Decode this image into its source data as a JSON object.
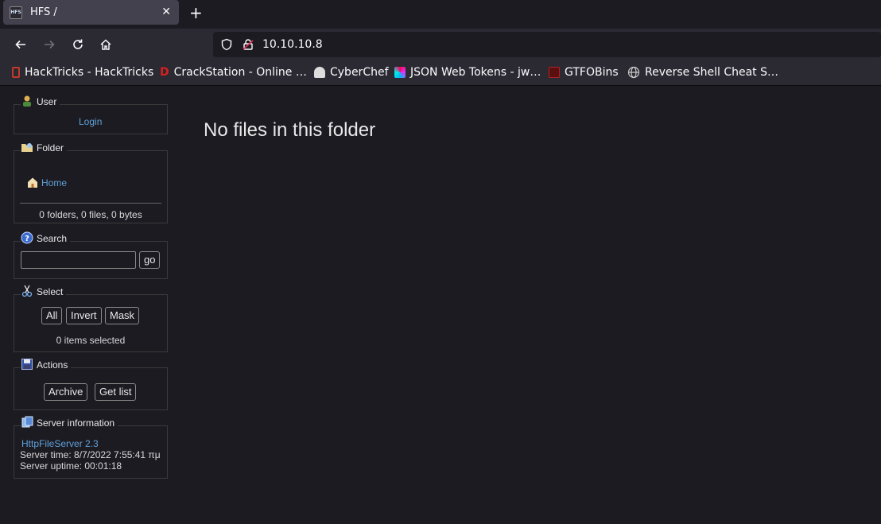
{
  "browser": {
    "tab_title": "HFS /",
    "tab_favicon_text": "HFS",
    "url": "10.10.10.8",
    "bookmarks": [
      {
        "label": "HackTricks - HackTricks",
        "icon": "hacktricks-icon",
        "color": "#c0392b"
      },
      {
        "label": "CrackStation - Online …",
        "icon": "crackstation-icon",
        "color": "#d62020"
      },
      {
        "label": "CyberChef",
        "icon": "cyberchef-icon",
        "color": "#dddddd"
      },
      {
        "label": "JSON Web Tokens - jw…",
        "icon": "jwt-icon",
        "color": "#8e44ad"
      },
      {
        "label": "GTFOBins",
        "icon": "gtfobins-icon",
        "color": "#b22222"
      },
      {
        "label": "Reverse Shell Cheat S…",
        "icon": "globe-icon",
        "color": "#cccccc"
      }
    ]
  },
  "sidebar": {
    "user": {
      "title": "User",
      "login_label": "Login"
    },
    "folder": {
      "title": "Folder",
      "home_label": "Home",
      "summary": "0 folders, 0 files, 0 bytes"
    },
    "search": {
      "title": "Search",
      "input_value": "",
      "go_label": "go"
    },
    "select": {
      "title": "Select",
      "all_label": "All",
      "invert_label": "Invert",
      "mask_label": "Mask",
      "status": "0 items selected"
    },
    "actions": {
      "title": "Actions",
      "archive_label": "Archive",
      "getlist_label": "Get list"
    },
    "server": {
      "title": "Server information",
      "version_link": "HttpFileServer 2.3",
      "time": "Server time: 8/7/2022 7:55:41 πμ",
      "uptime": "Server uptime: 00:01:18"
    }
  },
  "main": {
    "message": "No files in this folder"
  }
}
